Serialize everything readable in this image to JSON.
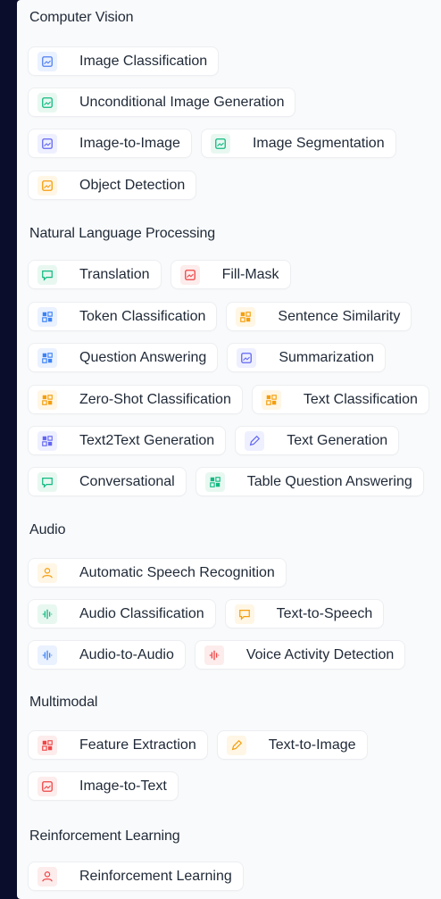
{
  "sections": [
    {
      "title": "Computer Vision",
      "rows": [
        [
          {
            "label": "Image Classification",
            "icon": "image-classification-icon",
            "color": "#4f7ff0",
            "bg": "#eaf1ff"
          }
        ],
        [
          {
            "label": "Unconditional Image Generation",
            "icon": "image-generation-icon",
            "color": "#10b981",
            "bg": "#e8f8f1"
          }
        ],
        [
          {
            "label": "Image-to-Image",
            "icon": "image-to-image-icon",
            "color": "#6366f1",
            "bg": "#eef0ff"
          },
          {
            "label": "Image Segmentation",
            "icon": "image-segmentation-icon",
            "color": "#10b981",
            "bg": "#e8f8f1"
          }
        ],
        [
          {
            "label": "Object Detection",
            "icon": "object-detection-icon",
            "color": "#f59e0b",
            "bg": "#fff6e5"
          }
        ]
      ]
    },
    {
      "title": "Natural Language Processing",
      "rows": [
        [
          {
            "label": "Translation",
            "icon": "translation-icon",
            "color": "#10b981",
            "bg": "#e8f8f1"
          },
          {
            "label": "Fill-Mask",
            "icon": "fill-mask-icon",
            "color": "#ef4444",
            "bg": "#fdecec"
          }
        ],
        [
          {
            "label": "Token Classification",
            "icon": "token-classification-icon",
            "color": "#3b82f6",
            "bg": "#eaf1ff"
          },
          {
            "label": "Sentence Similarity",
            "icon": "sentence-similarity-icon",
            "color": "#f59e0b",
            "bg": "#fff6e5"
          }
        ],
        [
          {
            "label": "Question Answering",
            "icon": "question-answering-icon",
            "color": "#3b82f6",
            "bg": "#eaf1ff"
          },
          {
            "label": "Summarization",
            "icon": "summarization-icon",
            "color": "#6366f1",
            "bg": "#eef0ff"
          }
        ],
        [
          {
            "label": "Zero-Shot Classification",
            "icon": "zero-shot-classification-icon",
            "color": "#f59e0b",
            "bg": "#fff6e5"
          },
          {
            "label": "Text Classification",
            "icon": "text-classification-icon",
            "color": "#f59e0b",
            "bg": "#fff6e5"
          }
        ],
        [
          {
            "label": "Text2Text Generation",
            "icon": "text2text-generation-icon",
            "color": "#6366f1",
            "bg": "#eef0ff"
          },
          {
            "label": "Text Generation",
            "icon": "text-generation-icon",
            "color": "#6366f1",
            "bg": "#eef0ff"
          }
        ],
        [
          {
            "label": "Conversational",
            "icon": "conversational-icon",
            "color": "#10b981",
            "bg": "#e8f8f1"
          },
          {
            "label": "Table Question Answering",
            "icon": "table-question-answering-icon",
            "color": "#10b981",
            "bg": "#e8f8f1"
          }
        ]
      ]
    },
    {
      "title": "Audio",
      "rows": [
        [
          {
            "label": "Automatic Speech Recognition",
            "icon": "speech-recognition-icon",
            "color": "#f59e0b",
            "bg": "#fff6e5"
          }
        ],
        [
          {
            "label": "Audio Classification",
            "icon": "audio-classification-icon",
            "color": "#10b981",
            "bg": "#e8f8f1"
          },
          {
            "label": "Text-to-Speech",
            "icon": "text-to-speech-icon",
            "color": "#f59e0b",
            "bg": "#fff6e5"
          }
        ],
        [
          {
            "label": "Audio-to-Audio",
            "icon": "audio-to-audio-icon",
            "color": "#3b82f6",
            "bg": "#eaf1ff"
          },
          {
            "label": "Voice Activity Detection",
            "icon": "voice-activity-detection-icon",
            "color": "#ef4444",
            "bg": "#fdecec"
          }
        ]
      ]
    },
    {
      "title": "Multimodal",
      "rows": [
        [
          {
            "label": "Feature Extraction",
            "icon": "feature-extraction-icon",
            "color": "#ef4444",
            "bg": "#fdecec"
          },
          {
            "label": "Text-to-Image",
            "icon": "text-to-image-icon",
            "color": "#f59e0b",
            "bg": "#fff6e5"
          }
        ],
        [
          {
            "label": "Image-to-Text",
            "icon": "image-to-text-icon",
            "color": "#ef4444",
            "bg": "#fdecec"
          }
        ]
      ]
    },
    {
      "title": "Reinforcement Learning",
      "rows": [
        [
          {
            "label": "Reinforcement Learning",
            "icon": "reinforcement-learning-icon",
            "color": "#ef4444",
            "bg": "#fdecec"
          }
        ]
      ]
    }
  ]
}
